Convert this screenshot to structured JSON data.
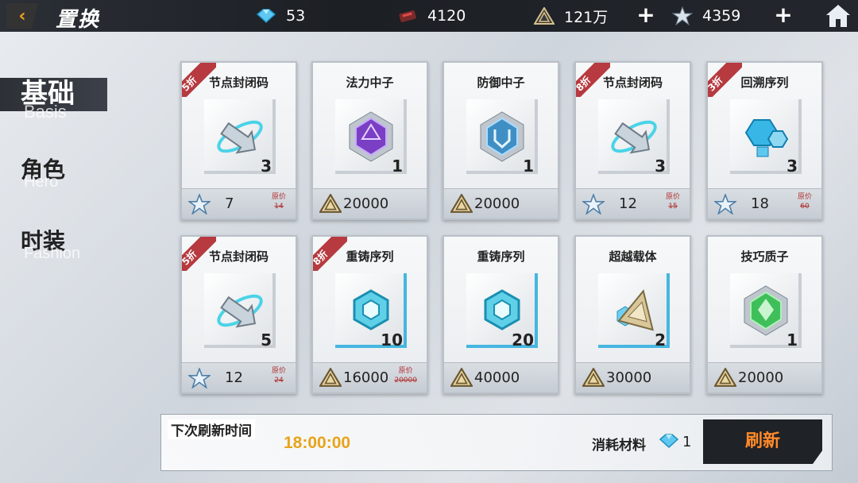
{
  "header": {
    "title": "置换",
    "back_icon": "back-arrow-icon",
    "home_icon": "home-icon",
    "resources": [
      {
        "name": "crystal",
        "icon": "blue-crystal-icon",
        "value": "53"
      },
      {
        "name": "chip",
        "icon": "red-chip-icon",
        "value": "4120"
      },
      {
        "name": "coin",
        "icon": "gold-triangle-coin-icon",
        "value": "121万"
      },
      {
        "name": "star",
        "icon": "silver-star-icon",
        "value": "4359"
      }
    ]
  },
  "sidebar": {
    "items": [
      {
        "cn": "基础",
        "en": "Basis",
        "active": true
      },
      {
        "cn": "角色",
        "en": "Hero",
        "active": false
      },
      {
        "cn": "时装",
        "en": "Fashion",
        "active": false
      }
    ]
  },
  "shop": {
    "items": [
      {
        "name": "节点封闭码",
        "qty": "3",
        "price": "7",
        "currency": "star",
        "orig_label": "原价",
        "orig_price": "14",
        "discount": "5折",
        "icon": "node-seal-code-icon",
        "accent": "grey"
      },
      {
        "name": "法力中子",
        "qty": "1",
        "price": "20000",
        "currency": "coin",
        "orig_label": "",
        "orig_price": "",
        "discount": "",
        "icon": "purple-mana-neutron-icon",
        "accent": "grey"
      },
      {
        "name": "防御中子",
        "qty": "1",
        "price": "20000",
        "currency": "coin",
        "orig_label": "",
        "orig_price": "",
        "discount": "",
        "icon": "blue-defense-neutron-icon",
        "accent": "grey"
      },
      {
        "name": "节点封闭码",
        "qty": "3",
        "price": "12",
        "currency": "star",
        "orig_label": "原价",
        "orig_price": "15",
        "discount": "8折",
        "icon": "node-seal-code-icon",
        "accent": "grey"
      },
      {
        "name": "回溯序列",
        "qty": "3",
        "price": "18",
        "currency": "star",
        "orig_label": "原价",
        "orig_price": "60",
        "discount": "3折",
        "icon": "rewind-sequence-icon",
        "accent": "grey"
      },
      {
        "name": "节点封闭码",
        "qty": "5",
        "price": "12",
        "currency": "star",
        "orig_label": "原价",
        "orig_price": "24",
        "discount": "5折",
        "icon": "node-seal-code-icon",
        "accent": "grey"
      },
      {
        "name": "重铸序列",
        "qty": "10",
        "price": "16000",
        "currency": "coin",
        "orig_label": "原价",
        "orig_price": "20000",
        "discount": "8折",
        "icon": "recast-sequence-icon",
        "accent": "blue"
      },
      {
        "name": "重铸序列",
        "qty": "20",
        "price": "40000",
        "currency": "coin",
        "orig_label": "",
        "orig_price": "",
        "discount": "",
        "icon": "recast-sequence-icon",
        "accent": "blue"
      },
      {
        "name": "超越载体",
        "qty": "2",
        "price": "30000",
        "currency": "coin",
        "orig_label": "",
        "orig_price": "",
        "discount": "",
        "icon": "transcend-carrier-icon",
        "accent": "blue"
      },
      {
        "name": "技巧质子",
        "qty": "1",
        "price": "20000",
        "currency": "coin",
        "orig_label": "",
        "orig_price": "",
        "discount": "",
        "icon": "green-skill-proton-icon",
        "accent": "grey"
      }
    ]
  },
  "footer": {
    "next_refresh_label": "下次刷新时间",
    "next_refresh_time": "18:00:00",
    "cost_label": "消耗材料",
    "cost_value": "1",
    "cost_icon": "blue-crystal-icon",
    "refresh_label": "刷新"
  }
}
